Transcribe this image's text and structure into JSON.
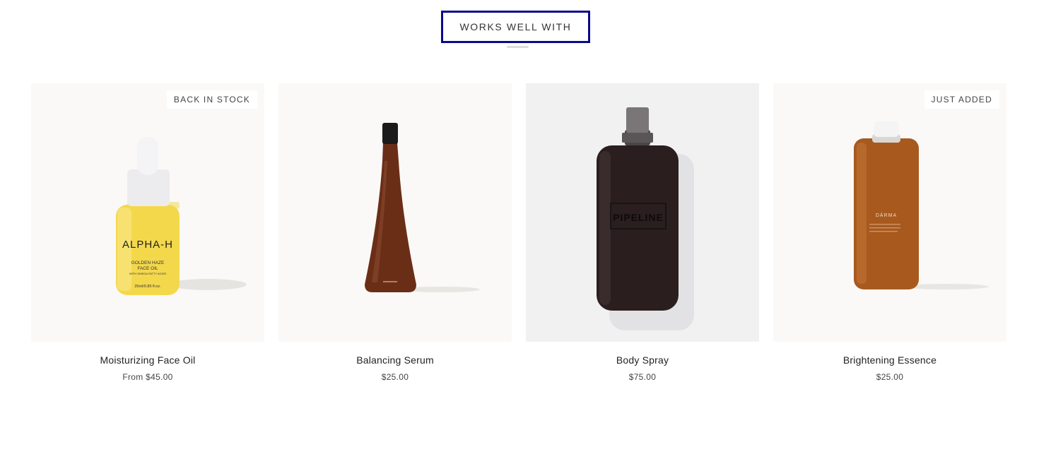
{
  "section": {
    "title": "WORKS WELL WITH"
  },
  "colors": {
    "accent_border": "#0a0a8c",
    "card_bg_warm": "#faf9f7",
    "card_bg_cool": "#f1f1f2"
  },
  "products": [
    {
      "name": "Moisturizing Face Oil",
      "price": "From $45.00",
      "badge": "BACK IN STOCK",
      "image_icon": "dropper-bottle-icon",
      "label": {
        "brand": "ALPHA-H",
        "line1": "GOLDEN HAZE",
        "line2": "FACE OIL",
        "line3": "WITH OMEGA FATTY ACIDS",
        "size": "25ml/0.85 fl.oz."
      }
    },
    {
      "name": "Balancing Serum",
      "price": "$25.00",
      "badge": "",
      "image_icon": "tall-bottle-icon"
    },
    {
      "name": "Body Spray",
      "price": "$75.00",
      "badge": "",
      "image_icon": "spray-bottle-icon",
      "label": {
        "brand": "PIPELINE"
      }
    },
    {
      "name": "Brightening Essence",
      "price": "$25.00",
      "badge": "JUST ADDED",
      "image_icon": "amber-bottle-icon",
      "label": {
        "brand": "DÁRMA"
      }
    }
  ]
}
